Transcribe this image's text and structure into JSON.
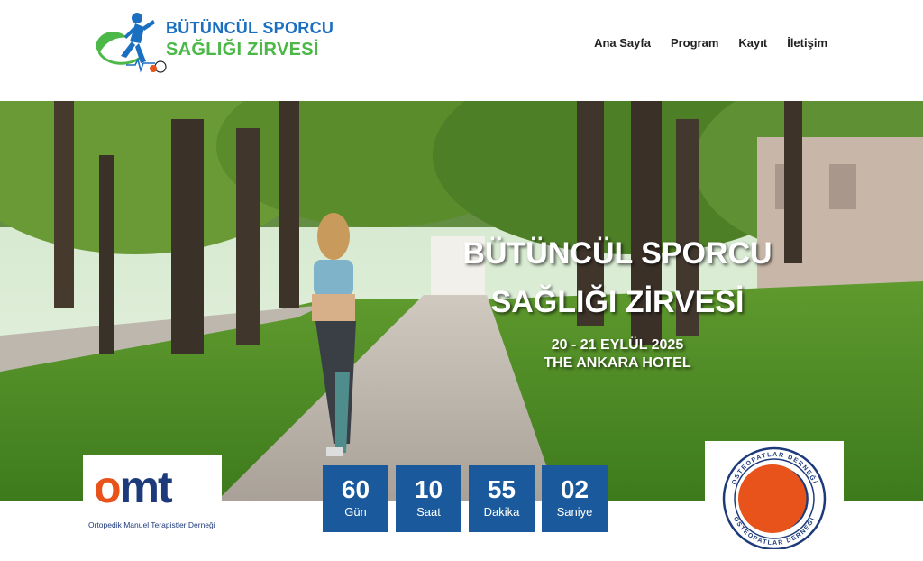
{
  "header": {
    "logo": {
      "line1": "BÜTÜNCÜL SPORCU",
      "line2": "SAĞLIĞI ZİRVESİ"
    },
    "nav": [
      {
        "label": "Ana Sayfa"
      },
      {
        "label": "Program"
      },
      {
        "label": "Kayıt"
      },
      {
        "label": "İletişim"
      }
    ]
  },
  "hero": {
    "title_line1": "BÜTÜNCÜL SPORCU",
    "title_line2": "SAĞLIĞI ZİRVESİ",
    "date": "20 - 21 EYLÜL 2025",
    "venue": "THE ANKARA HOTEL"
  },
  "countdown": [
    {
      "value": "60",
      "unit": "Gün"
    },
    {
      "value": "10",
      "unit": "Saat"
    },
    {
      "value": "55",
      "unit": "Dakika"
    },
    {
      "value": "02",
      "unit": "Saniye"
    }
  ],
  "sponsors": {
    "omt": {
      "letters_o": "o",
      "letters_mt": "mt",
      "caption": "Ortopedik Manuel Terapistler Derneği"
    },
    "osteo": {
      "ring_text": "OSTEOPATLAR DERNEĞİ"
    }
  },
  "colors": {
    "brand_blue": "#1a6fc0",
    "brand_green": "#4cb848",
    "countdown_bg": "#1a5a9c",
    "omt_orange": "#e8521b",
    "omt_navy": "#1d3a7a"
  }
}
